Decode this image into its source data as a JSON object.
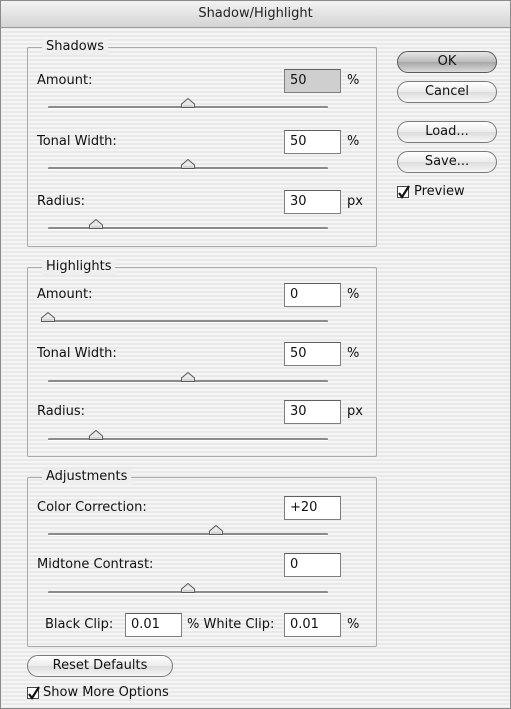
{
  "window": {
    "title": "Shadow/Highlight"
  },
  "buttons": {
    "ok": "OK",
    "cancel": "Cancel",
    "load": "Load...",
    "save": "Save...",
    "reset": "Reset Defaults"
  },
  "preview": {
    "label": "Preview",
    "checked": true
  },
  "show_more": {
    "label": "Show More Options",
    "checked": true
  },
  "shadows": {
    "legend": "Shadows",
    "amount": {
      "label": "Amount:",
      "value": "50",
      "unit": "%",
      "level": 0.5
    },
    "tonal_width": {
      "label": "Tonal Width:",
      "value": "50",
      "unit": "%",
      "level": 0.5
    },
    "radius": {
      "label": "Radius:",
      "value": "30",
      "unit": "px",
      "level": 0.17
    }
  },
  "highlights": {
    "legend": "Highlights",
    "amount": {
      "label": "Amount:",
      "value": "0",
      "unit": "%",
      "level": 0.0
    },
    "tonal_width": {
      "label": "Tonal Width:",
      "value": "50",
      "unit": "%",
      "level": 0.5
    },
    "radius": {
      "label": "Radius:",
      "value": "30",
      "unit": "px",
      "level": 0.17
    }
  },
  "adjustments": {
    "legend": "Adjustments",
    "color_correction": {
      "label": "Color Correction:",
      "value": "+20",
      "level": 0.6
    },
    "midtone_contrast": {
      "label": "Midtone Contrast:",
      "value": "0",
      "level": 0.5
    },
    "black_clip": {
      "label": "Black Clip:",
      "value": "0.01",
      "unit": "%"
    },
    "white_clip": {
      "label": "% White Clip:",
      "value": "0.01",
      "unit": "%"
    }
  }
}
